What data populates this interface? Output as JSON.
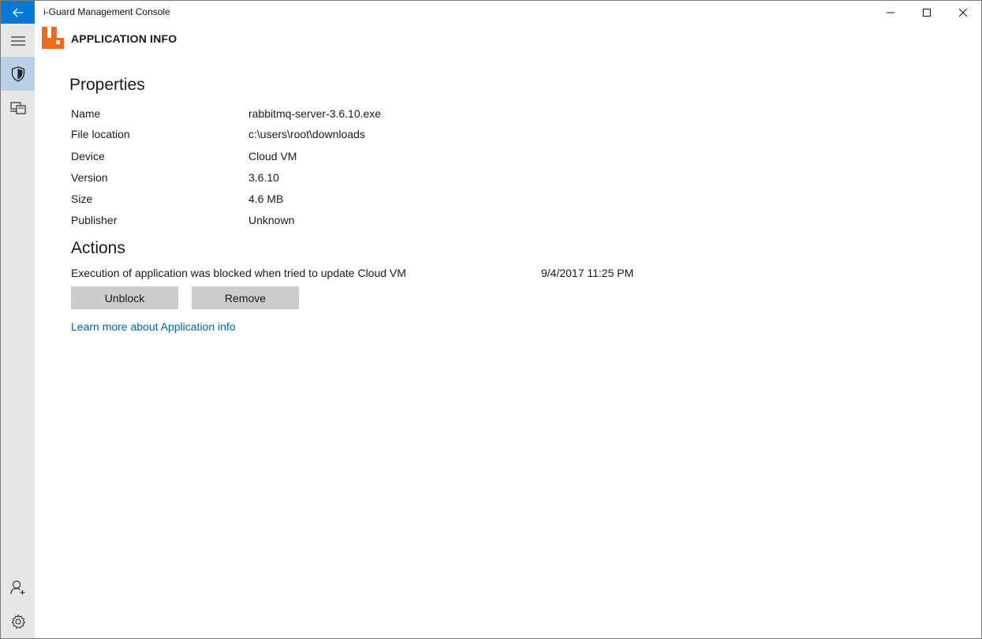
{
  "window": {
    "title": "i-Guard Management Console"
  },
  "header": {
    "title": "APPLICATION INFO",
    "logo_icon": "rabbitmq-logo-icon",
    "logo_color": "#f26822"
  },
  "nav": {
    "items": [
      {
        "icon": "back-arrow-icon"
      },
      {
        "icon": "hamburger-menu-icon"
      },
      {
        "icon": "shield-icon",
        "selected": true
      },
      {
        "icon": "devices-icon"
      },
      {
        "icon": "add-user-icon"
      },
      {
        "icon": "gear-icon"
      }
    ],
    "accent": "#0078d7",
    "selected_bg": "#b9d1e8"
  },
  "properties": {
    "heading": "Properties",
    "rows": [
      {
        "label": "Name",
        "value": "rabbitmq-server-3.6.10.exe"
      },
      {
        "label": "File location",
        "value": "c:\\users\\root\\downloads"
      },
      {
        "label": "Device",
        "value": "Cloud VM"
      },
      {
        "label": "Version",
        "value": "3.6.10"
      },
      {
        "label": "Size",
        "value": "4.6 MB"
      },
      {
        "label": "Publisher",
        "value": "Unknown"
      }
    ]
  },
  "actions": {
    "heading": "Actions",
    "event_text": "Execution of application was blocked when tried to update Cloud VM",
    "event_time": "9/4/2017 11:25 PM",
    "unblock_label": "Unblock",
    "remove_label": "Remove",
    "learn_more": "Learn more about Application info",
    "link_color": "#0063b1"
  }
}
